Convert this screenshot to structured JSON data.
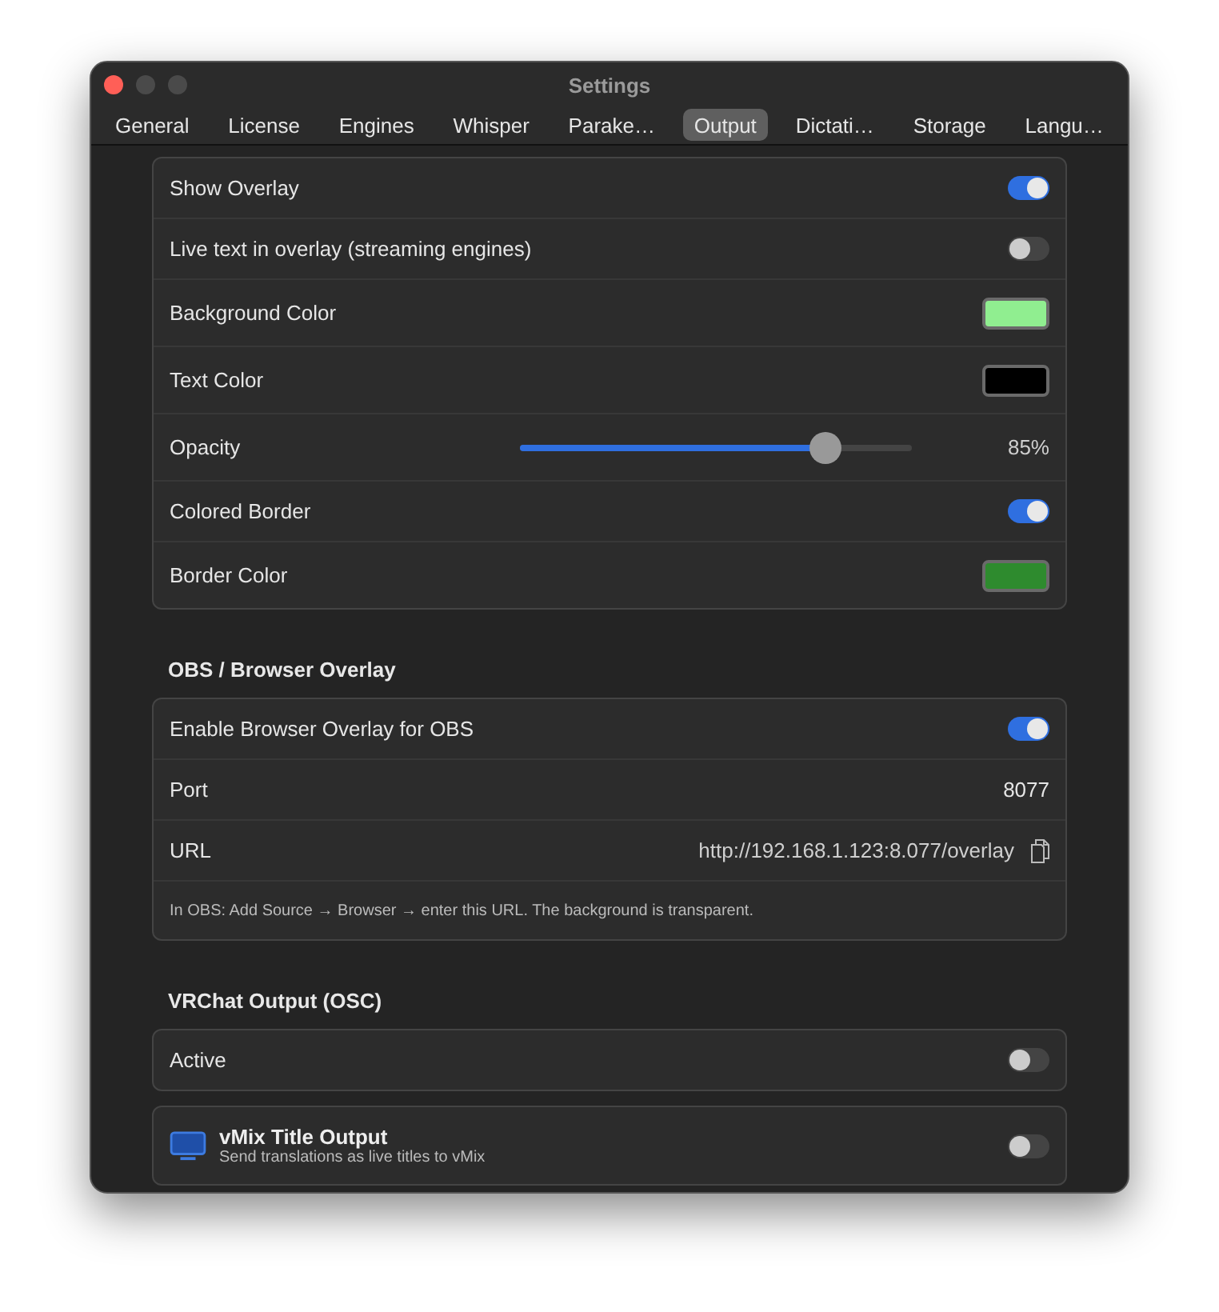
{
  "window": {
    "title": "Settings"
  },
  "tabs": [
    {
      "label": "General",
      "selected": false
    },
    {
      "label": "License",
      "selected": false
    },
    {
      "label": "Engines",
      "selected": false
    },
    {
      "label": "Whisper",
      "selected": false
    },
    {
      "label": "Parake…",
      "selected": false
    },
    {
      "label": "Output",
      "selected": true
    },
    {
      "label": "Dictati…",
      "selected": false
    },
    {
      "label": "Storage",
      "selected": false
    },
    {
      "label": "Langu…",
      "selected": false
    }
  ],
  "sections": [
    {
      "rows": [
        {
          "kind": "toggle",
          "label": "Show Overlay",
          "on": true
        },
        {
          "kind": "toggle",
          "label": "Live text in overlay (streaming engines)",
          "on": false
        },
        {
          "kind": "color",
          "label": "Background Color",
          "color": "#90ee90"
        },
        {
          "kind": "color",
          "label": "Text Color",
          "color": "#000000"
        },
        {
          "kind": "slider",
          "label": "Opacity",
          "level": 0.78,
          "reading": "85%"
        },
        {
          "kind": "toggle",
          "label": "Colored Border",
          "on": true
        },
        {
          "kind": "color",
          "label": "Border Color",
          "color": "#2e8b2e"
        }
      ]
    },
    {
      "heading": "OBS / Browser Overlay",
      "rows": [
        {
          "kind": "toggle",
          "label": "Enable Browser Overlay for OBS",
          "on": true
        },
        {
          "kind": "value",
          "label": "Port",
          "value": "8077"
        },
        {
          "kind": "url",
          "label": "URL",
          "value": "http://192.168.1.123:8.077/overlay"
        },
        {
          "kind": "note",
          "label": "In OBS: Add Source → Browser → enter this URL. The background is transparent."
        }
      ]
    },
    {
      "heading": "VRChat Output (OSC)",
      "rows": [
        {
          "kind": "toggle",
          "label": "Active",
          "on": false
        }
      ]
    },
    {
      "rows": [
        {
          "kind": "feature",
          "label": "vMix Title Output",
          "subtitle": "Send translations as live titles to vMix",
          "on": false
        }
      ]
    }
  ]
}
